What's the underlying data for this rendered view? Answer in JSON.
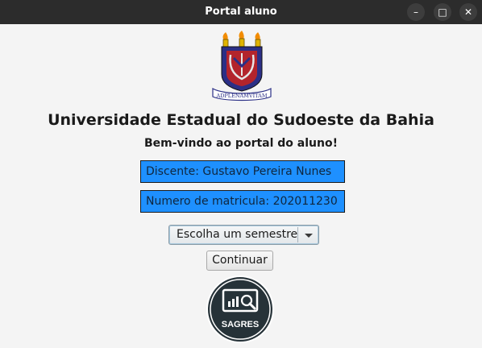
{
  "window": {
    "title": "Portal aluno",
    "minimize_label": "–",
    "maximize_label": "□",
    "close_label": "✕"
  },
  "header": {
    "university_name": "Universidade Estadual do Sudoeste da Bahia",
    "welcome": "Bem-vindo ao portal do aluno!",
    "crest_motto": "ADPLENAMVITAM"
  },
  "student": {
    "name_text": "Discente: Gustavo Pereira Nunes",
    "registration_text": "Numero de matricula: 202011230"
  },
  "form": {
    "semester_select_label": "Escolha um semestre",
    "continue_label": "Continuar"
  },
  "sagres": {
    "label": "SAGRES",
    "icon": "monitor-search-icon"
  },
  "colors": {
    "titlebar": "#2c2c2c",
    "info_field_bg": "#1e90ff",
    "sagres_bg": "#263238"
  }
}
